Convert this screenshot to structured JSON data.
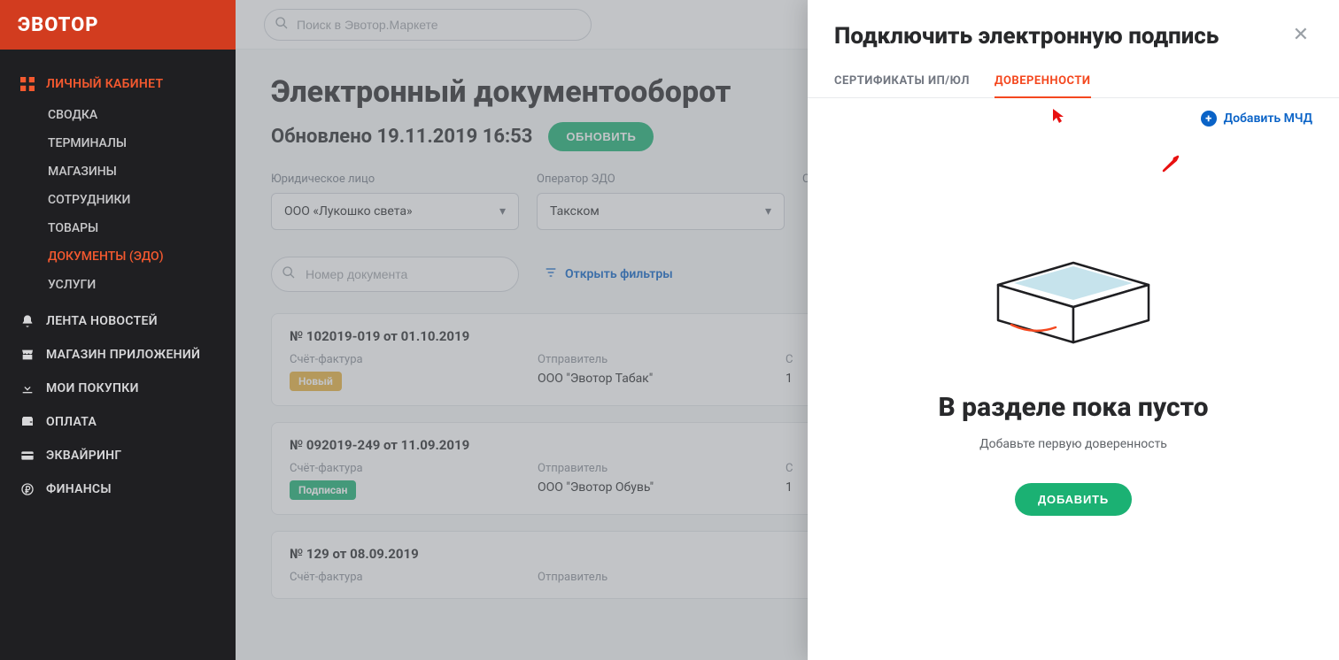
{
  "brand": "ЭВОТОР",
  "topbar": {
    "search_placeholder": "Поиск в Эвотор.Маркете"
  },
  "nav": {
    "personal": "ЛИЧНЫЙ КАБИНЕТ",
    "sub": {
      "summary": "СВОДКА",
      "terminals": "ТЕРМИНАЛЫ",
      "shops": "МАГАЗИНЫ",
      "employees": "СОТРУДНИКИ",
      "goods": "ТОВАРЫ",
      "documents": "ДОКУМЕНТЫ (ЭДО)",
      "services": "УСЛУГИ"
    },
    "news": "ЛЕНТА НОВОСТЕЙ",
    "market": "МАГАЗИН ПРИЛОЖЕНИЙ",
    "purchases": "МОИ ПОКУПКИ",
    "payment": "ОПЛАТА",
    "acquiring": "ЭКВАЙРИНГ",
    "finance": "ФИНАНСЫ"
  },
  "page": {
    "title": "Электронный документооборот",
    "updated": "Обновлено 19.11.2019 16:53",
    "refresh_label": "ОБНОВИТЬ"
  },
  "org": {
    "name": "ООО «Лукошко света»",
    "id": "475345С1000CEFR23"
  },
  "filters": {
    "entity_label": "Юридическое лицо",
    "entity_value": "ООО «Лукошко света»",
    "operator_label": "Оператор ЭДО",
    "operator_value": "Такском",
    "third_label": "С"
  },
  "doc_search": {
    "placeholder": "Номер документа",
    "open_filters": "Открыть фильтры"
  },
  "docs": [
    {
      "title": "№ 102019-019 от 01.10.2019",
      "type_label": "Счёт-фактура",
      "sender_label": "Отправитель",
      "sender": "ООО \"Эвотор Табак\"",
      "sum_label": "С",
      "sum": "1",
      "badge": "Новый",
      "badge_class": "new"
    },
    {
      "title": "№ 092019-249 от 11.09.2019",
      "type_label": "Счёт-фактура",
      "sender_label": "Отправитель",
      "sender": "ООО \"Эвотор Обувь\"",
      "sum_label": "С",
      "sum": "1",
      "badge": "Подписан",
      "badge_class": "signed"
    },
    {
      "title": "№ 129 от 08.09.2019",
      "type_label": "Счёт-фактура",
      "sender_label": "Отправитель",
      "sender": "",
      "sum_label": "",
      "sum": "",
      "badge": "",
      "badge_class": ""
    }
  ],
  "panel": {
    "title": "Подключить электронную подпись",
    "tabs": {
      "certs": "СЕРТИФИКАТЫ ИП/ЮЛ",
      "proxy": "ДОВЕРЕННОСТИ"
    },
    "add_link": "Добавить МЧД",
    "empty_title": "В разделе пока пусто",
    "empty_sub": "Добавьте первую доверенность",
    "add_button": "ДОБАВИТЬ"
  }
}
